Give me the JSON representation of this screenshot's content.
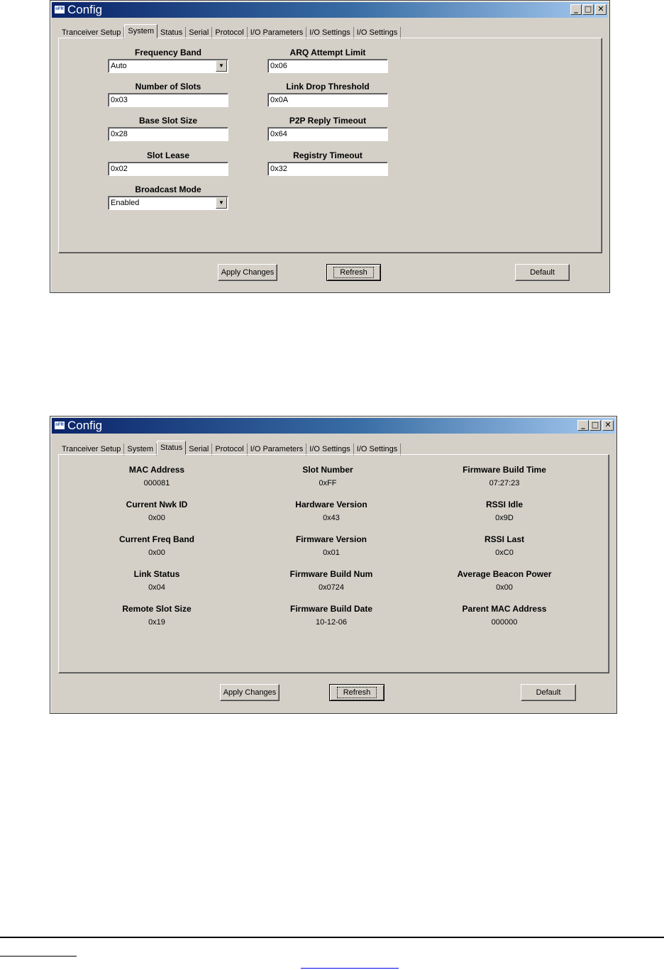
{
  "window1": {
    "title": "Config",
    "app_icon_text": "nFR",
    "caption": {
      "minimize": "_",
      "maximize": "□",
      "close": "✕"
    },
    "tabs": [
      "Tranceiver Setup",
      "System",
      "Status",
      "Serial",
      "Protocol",
      "I/O Parameters",
      "I/O Settings",
      "I/O Settings"
    ],
    "active_tab": "System",
    "fields": {
      "frequency_band": {
        "label": "Frequency Band",
        "value": "Auto"
      },
      "number_of_slots": {
        "label": "Number of Slots",
        "value": "0x03"
      },
      "base_slot_size": {
        "label": "Base Slot Size",
        "value": "0x28"
      },
      "slot_lease": {
        "label": "Slot Lease",
        "value": "0x02"
      },
      "broadcast_mode": {
        "label": "Broadcast Mode",
        "value": "Enabled"
      },
      "arq_attempt_limit": {
        "label": "ARQ Attempt Limit",
        "value": "0x06"
      },
      "link_drop_threshold": {
        "label": "Link Drop Threshold",
        "value": "0x0A"
      },
      "p2p_reply_timeout": {
        "label": "P2P Reply Timeout",
        "value": "0x64"
      },
      "registry_timeout": {
        "label": "Registry Timeout",
        "value": "0x32"
      }
    },
    "buttons": {
      "apply": "Apply Changes",
      "refresh": "Refresh",
      "default": "Default"
    }
  },
  "window2": {
    "title": "Config",
    "app_icon_text": "nFR",
    "caption": {
      "minimize": "_",
      "maximize": "□",
      "close": "✕"
    },
    "tabs": [
      "Tranceiver Setup",
      "System",
      "Status",
      "Serial",
      "Protocol",
      "I/O Parameters",
      "I/O Settings",
      "I/O Settings"
    ],
    "active_tab": "Status",
    "status": [
      {
        "label": "MAC Address",
        "value": "000081"
      },
      {
        "label": "Current Nwk ID",
        "value": "0x00"
      },
      {
        "label": "Current Freq Band",
        "value": "0x00"
      },
      {
        "label": "Link Status",
        "value": "0x04"
      },
      {
        "label": "Remote Slot Size",
        "value": "0x19"
      },
      {
        "label": "Slot Number",
        "value": "0xFF"
      },
      {
        "label": "Hardware Version",
        "value": "0x43"
      },
      {
        "label": "Firmware Version",
        "value": "0x01"
      },
      {
        "label": "Firmware Build Num",
        "value": "0x0724"
      },
      {
        "label": "Firmware Build Date",
        "value": "10-12-06"
      },
      {
        "label": "Firmware Build Time",
        "value": "07:27:23"
      },
      {
        "label": "RSSI Idle",
        "value": "0x9D"
      },
      {
        "label": "RSSI Last",
        "value": "0xC0"
      },
      {
        "label": "Average Beacon Power",
        "value": "0x00"
      },
      {
        "label": "Parent MAC Address",
        "value": "000000"
      }
    ],
    "buttons": {
      "apply": "Apply Changes",
      "refresh": "Refresh",
      "default": "Default"
    }
  }
}
